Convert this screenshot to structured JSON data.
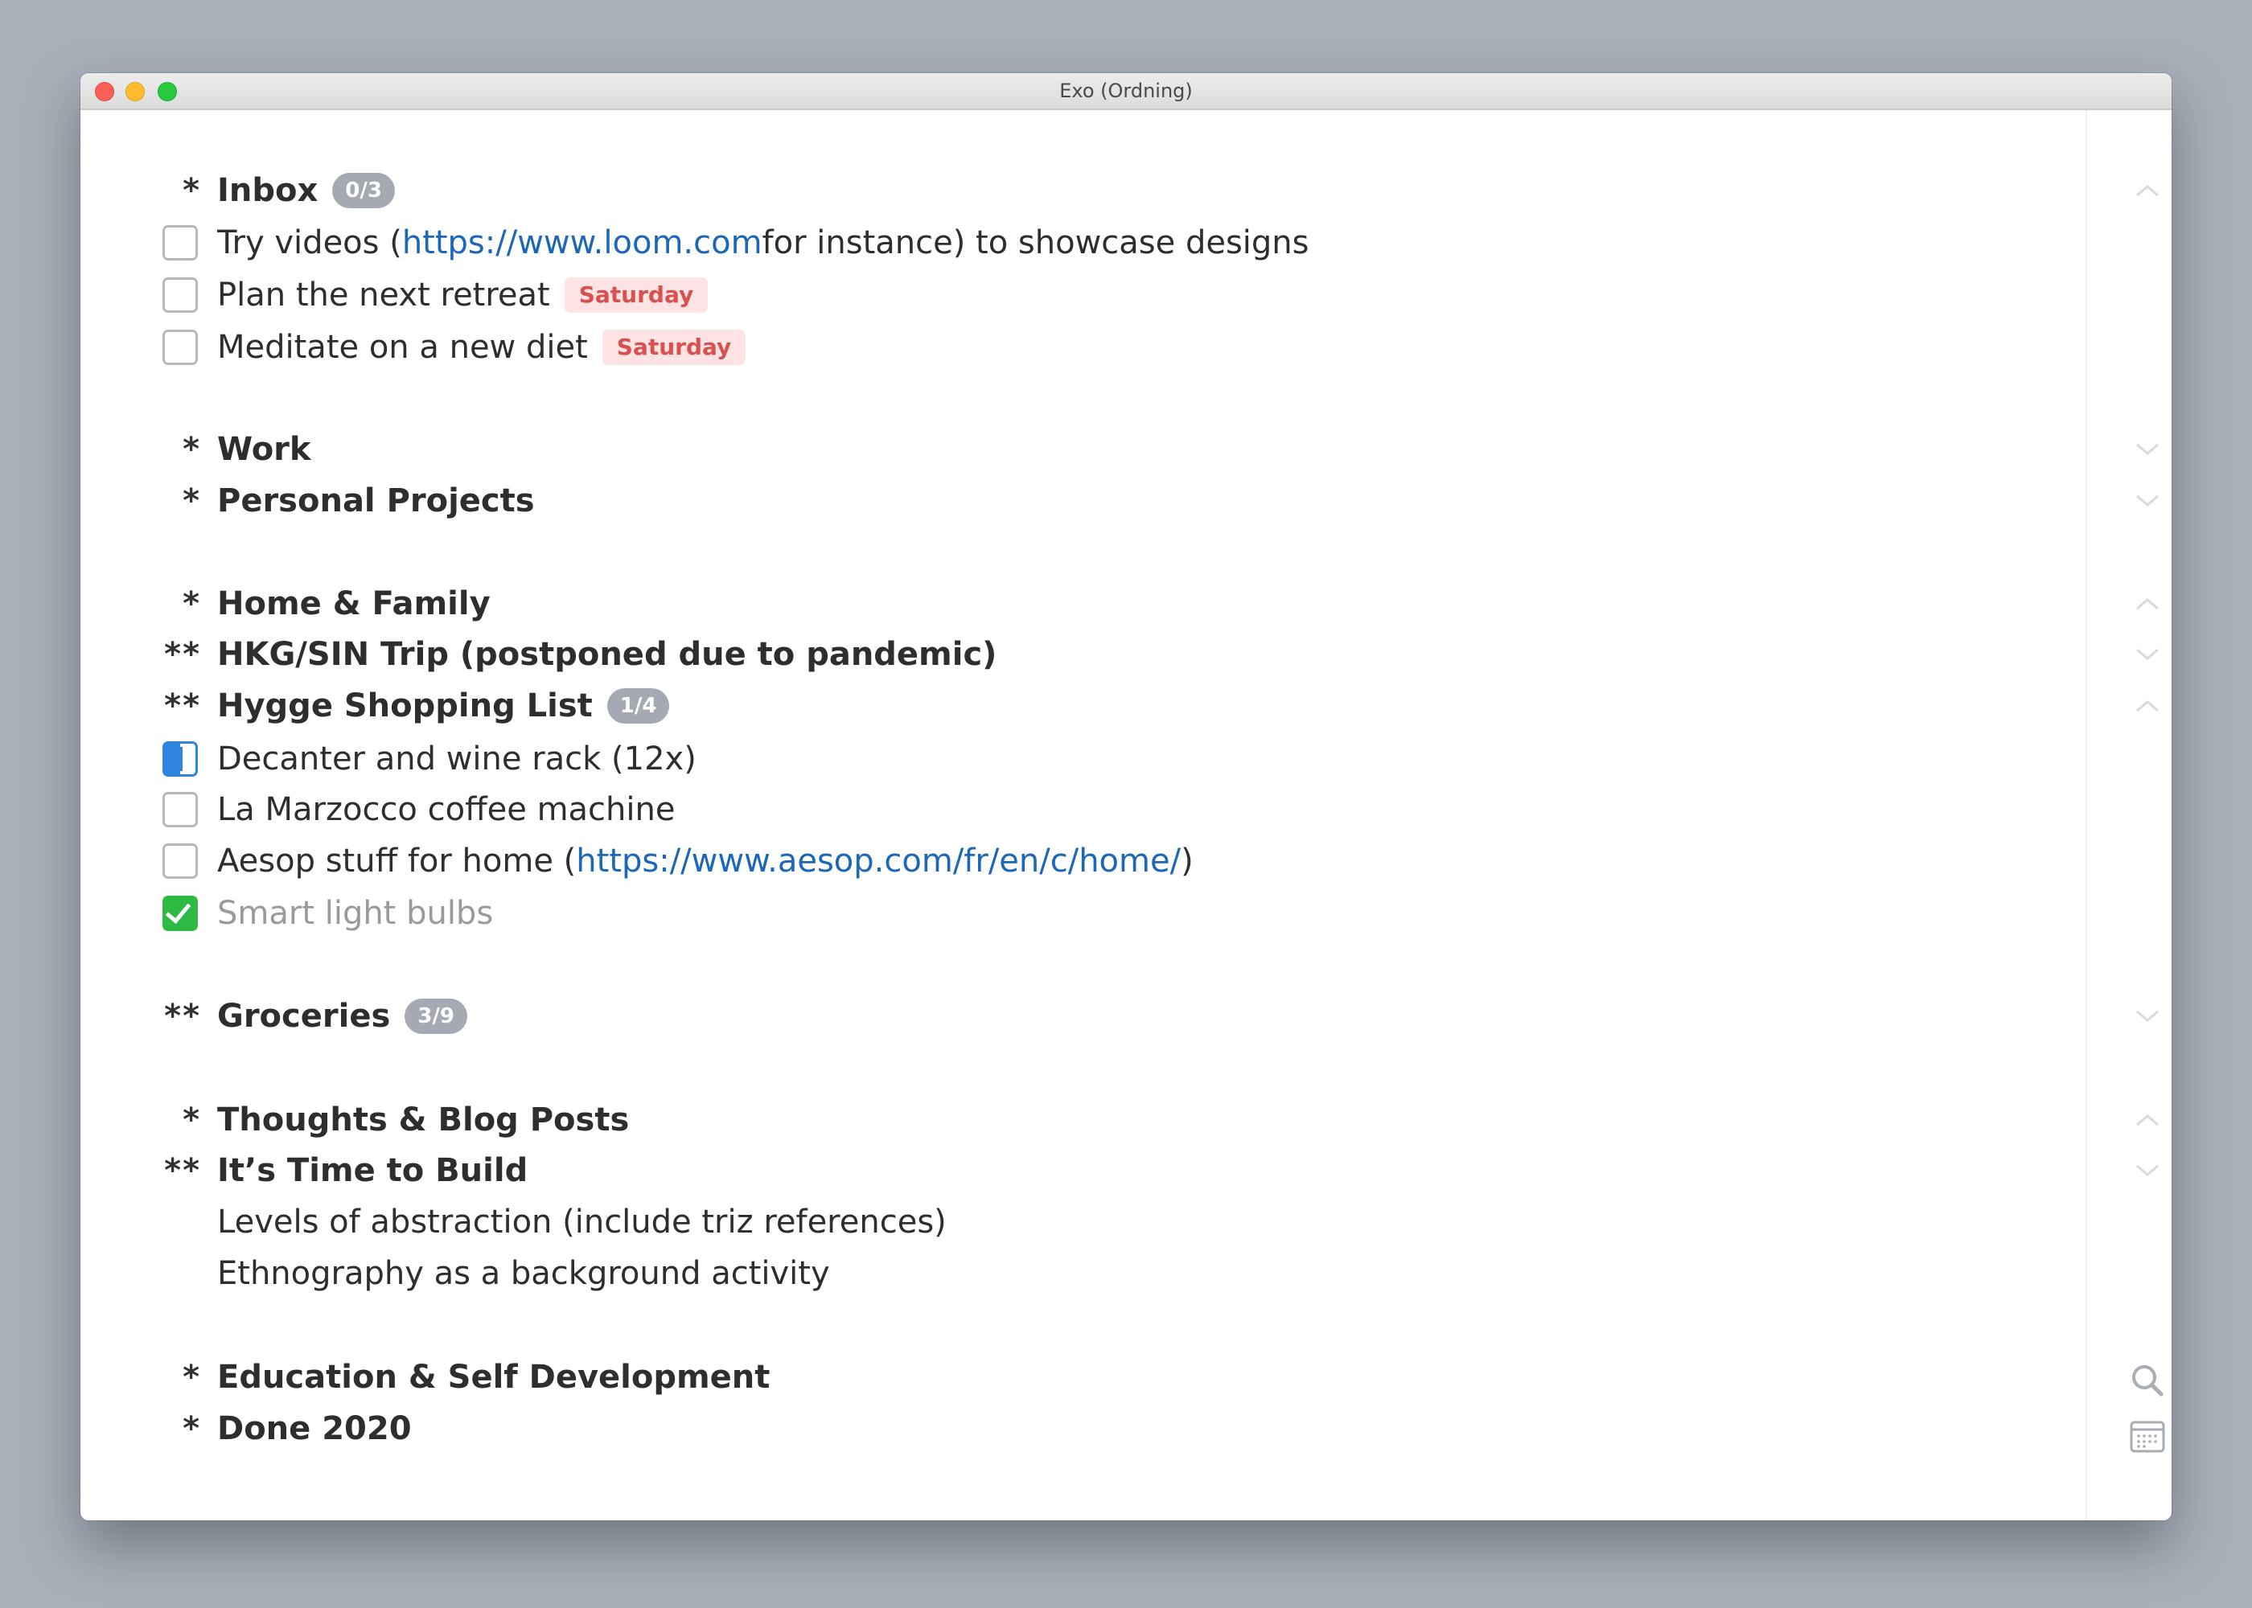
{
  "window": {
    "title": "Exo (Ordning)"
  },
  "sections": {
    "inbox": {
      "marker": "*",
      "title": "Inbox",
      "badge": "0/3",
      "tasks": [
        {
          "text_before": "Try videos (",
          "link": "https://www.loom.com",
          "text_after": " for instance) to showcase designs",
          "state": "open"
        },
        {
          "text": "Plan the next retreat",
          "date": "Saturday",
          "state": "open"
        },
        {
          "text": "Meditate on a new diet",
          "date": "Saturday",
          "state": "open"
        }
      ]
    },
    "work": {
      "marker": "*",
      "title": "Work"
    },
    "personal": {
      "marker": "*",
      "title": "Personal Projects"
    },
    "home": {
      "marker": "*",
      "title": "Home & Family"
    },
    "hkg": {
      "marker": "**",
      "title": "HKG/SIN Trip (postponed due to pandemic)"
    },
    "hygge": {
      "marker": "**",
      "title": "Hygge Shopping List",
      "badge": "1/4",
      "tasks": [
        {
          "text": "Decanter and wine rack (12x)",
          "state": "in-progress"
        },
        {
          "text": "La Marzocco coffee machine",
          "state": "open"
        },
        {
          "text_before": "Aesop stuff for home (",
          "link": "https://www.aesop.com/fr/en/c/home/",
          "text_after": ")",
          "state": "open"
        },
        {
          "text": "Smart light bulbs",
          "state": "done"
        }
      ]
    },
    "groceries": {
      "marker": "**",
      "title": "Groceries",
      "badge": "3/9"
    },
    "thoughts": {
      "marker": "*",
      "title": "Thoughts & Blog Posts"
    },
    "build": {
      "marker": "**",
      "title": "It’s Time to Build",
      "notes": [
        "Levels of abstraction (include triz references)",
        "Ethnography as a background activity"
      ]
    },
    "education": {
      "marker": "*",
      "title": "Education & Self Development"
    },
    "done2020": {
      "marker": "*",
      "title": "Done 2020"
    }
  },
  "tools": {
    "search_icon": "search-icon",
    "calendar_icon": "calendar-icon"
  },
  "colors": {
    "link": "#1d67b8",
    "date_tag_bg": "#fde3e3",
    "date_tag_text": "#d8504f",
    "badge_bg": "#a4a9b2",
    "checked": "#2eb844",
    "in_progress": "#2e85e0"
  }
}
